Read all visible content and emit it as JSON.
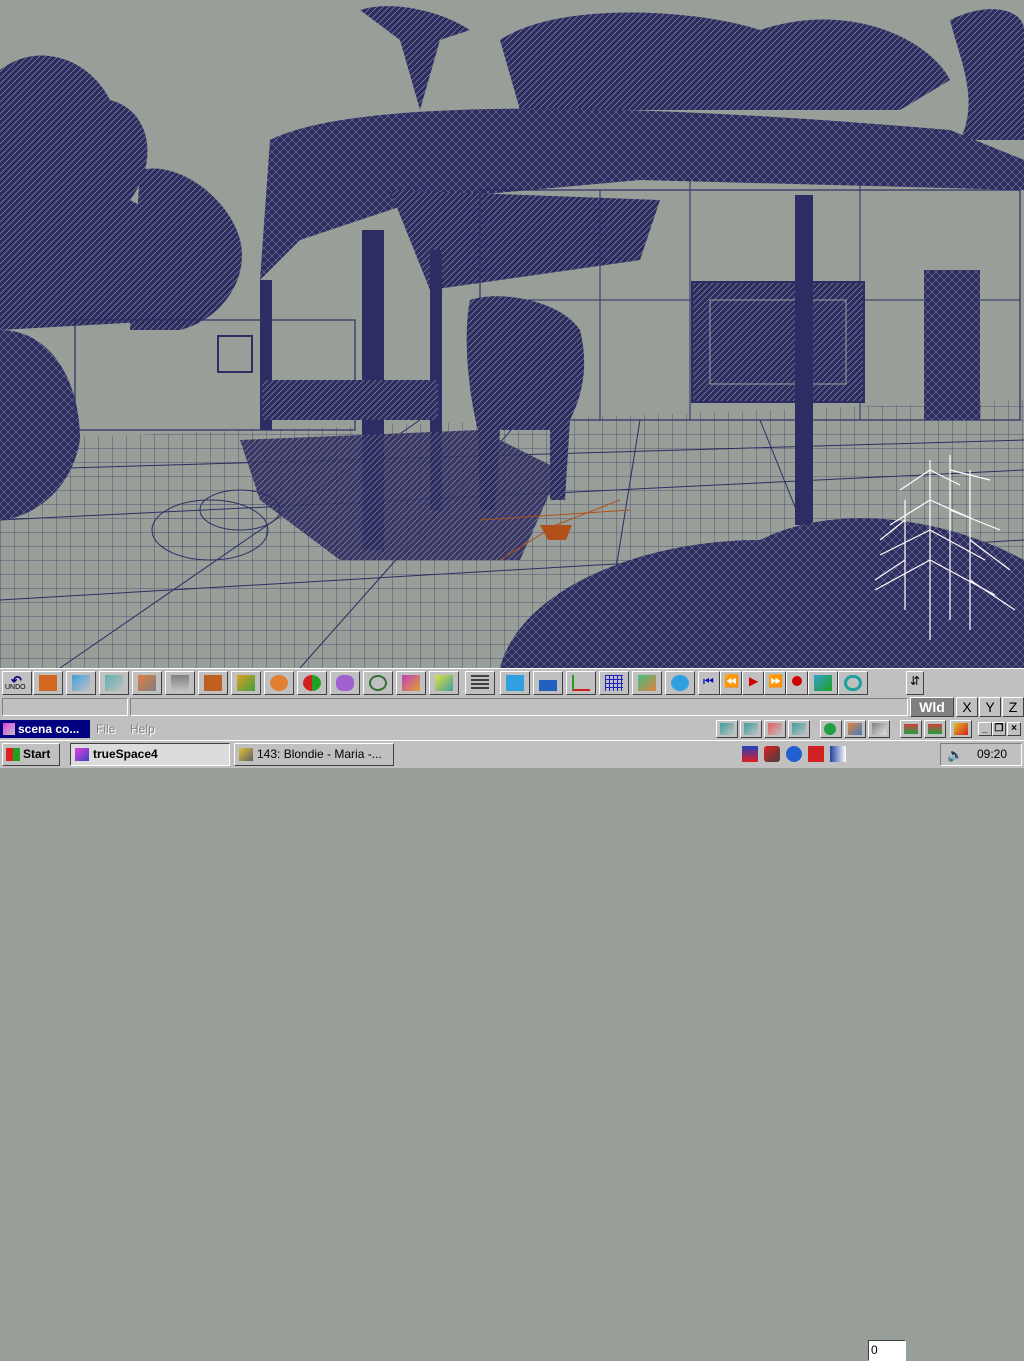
{
  "toolbar": {
    "undo_label": "UNDO",
    "tools": [
      "object-tool",
      "point-edit-tool",
      "select-tool",
      "eye-move-tool",
      "object-info-tool",
      "scale-tool",
      "rotate-tool",
      "sphere-tool",
      "material-tool",
      "metaball-tool",
      "sweep-tool",
      "paint-tool",
      "render-tool",
      "grid-tool",
      "cube-primitive-tool",
      "figure-tool",
      "axes-tool",
      "snap-grid-tool",
      "view-tool",
      "3d-text-tool"
    ],
    "frame_value": "0"
  },
  "coords": {
    "wld_label": "Wld",
    "x_label": "X",
    "y_label": "Y",
    "z_label": "Z"
  },
  "menu": {
    "doc_title": "scena co...",
    "file": "File",
    "help": "Help"
  },
  "taskbar": {
    "start": "Start",
    "tasks": [
      {
        "label": "trueSpace4",
        "active": true
      },
      {
        "label": "143: Blondie - Maria -...",
        "active": false
      }
    ],
    "clock": "09:20"
  },
  "colors": {
    "wireframe": "#2e2d63",
    "viewport_bg": "#979f98",
    "selected": "#ffffff",
    "camera": "#b0501a"
  }
}
